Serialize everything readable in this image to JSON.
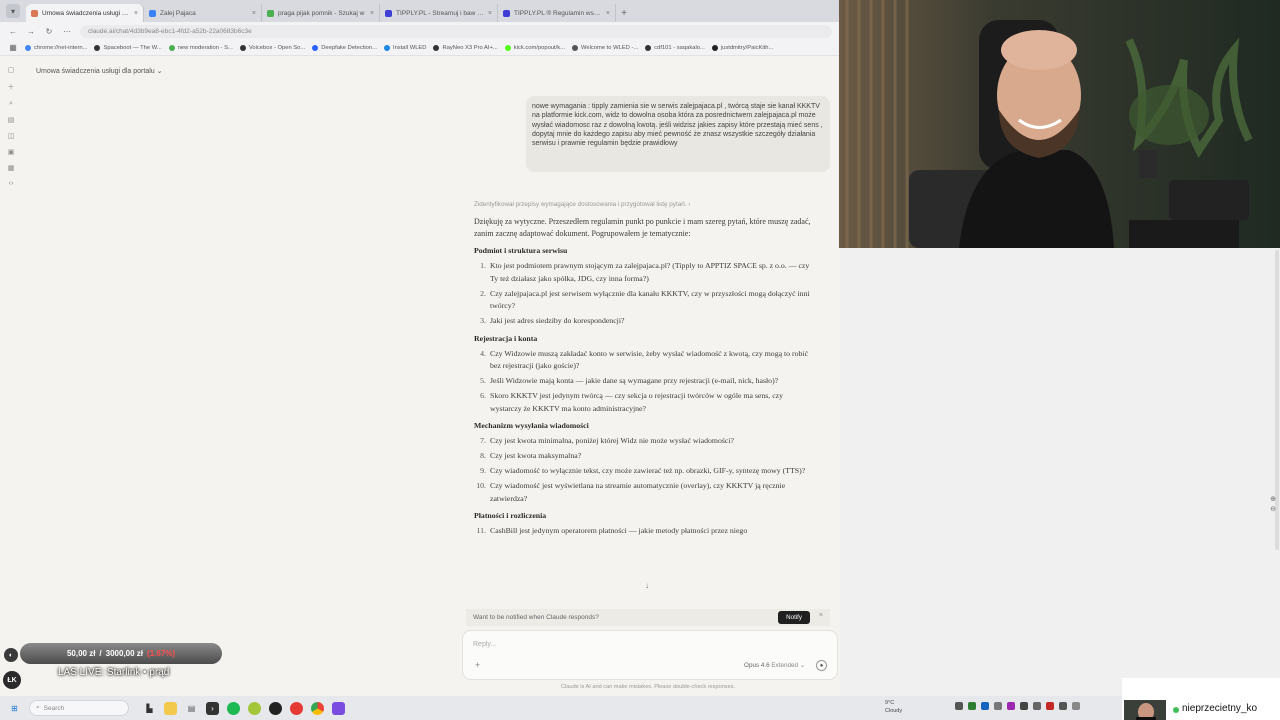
{
  "browser": {
    "tabs": [
      {
        "title": "Umowa świadczenia usługi dla",
        "color": "#d97757",
        "active": true
      },
      {
        "title": "Zalej Pajaca",
        "color": "#3b82f6",
        "active": false
      },
      {
        "title": "praga pijak pomnik - Szukaj w",
        "color": "#4caf50",
        "active": false
      },
      {
        "title": "TIPPLY.PL - Streamuj i baw się",
        "color": "#3f3fd8",
        "active": false
      },
      {
        "title": "TIPPLY.PL ® Regulamin współp",
        "color": "#3f3fd8",
        "active": false
      }
    ],
    "url": "claude.ai/chat/4d3b9ea8-ebc1-4fd2-a52b-22a0683b6c3e",
    "bookmarks": [
      {
        "label": "chrome://net-intern...",
        "color": "#4285f4"
      },
      {
        "label": "Spaceboot — The W...",
        "color": "#333333"
      },
      {
        "label": "new moderation - S...",
        "color": "#4caf50"
      },
      {
        "label": "Voicebox - Open So...",
        "color": "#333333"
      },
      {
        "label": "Deepfake Detection...",
        "color": "#2962ff"
      },
      {
        "label": "Install WLED",
        "color": "#1e88e5"
      },
      {
        "label": "RayNeo X3 Pro AI+...",
        "color": "#333333"
      },
      {
        "label": "kick.com/popout/k...",
        "color": "#53fc18"
      },
      {
        "label": "Welcome to WLED -...",
        "color": "#555555"
      },
      {
        "label": "cdf101 - saqakalo...",
        "color": "#333333"
      },
      {
        "label": "justdmitry/PaicKith...",
        "color": "#222222"
      }
    ]
  },
  "conversation": {
    "title": "Umowa świadczenia usługi dla portalu",
    "user_message": "nowe wymagania : tipply zamienia sie w serwis zalejpajaca.pl , twórcą staje sie kanał KKKTV na platformie kick.com, widz to dowolna osoba która za posrednictwem zalejpajaca.pl może wysłać wiadomosc raz z dowolną kwotą. jeśli widzisz jakies zapisy które przestają mieć sens , dopytaj mnie do każdego zapisu aby mieć pewność że znasz wszystkie szczegóły działania serwisu i prawnie regulamin będzie prawidłowy",
    "thinking": "Zidentyfikował przepisy wymagające dostosowania i przygotował listę pytań.",
    "intro": "Dziękuję za wytyczne. Przeszedłem regulamin punkt po punkcie i mam szereg pytań, które muszę zadać, zanim zacznę adaptować dokument. Pogrupowałem je tematycznie:",
    "sections": [
      {
        "heading": "Podmiot i struktura serwisu",
        "questions": [
          {
            "n": "1.",
            "text": "Kto jest podmiotem prawnym stojącym za zalejpajaca.pl? (Tipply to APPTIZ SPACE sp. z o.o. — czy Ty też działasz jako spółka, JDG, czy inna forma?)"
          },
          {
            "n": "2.",
            "text": "Czy zalejpajaca.pl jest serwisem wyłącznie dla kanału KKKTV, czy w przyszłości mogą dołączyć inni twórcy?"
          },
          {
            "n": "3.",
            "text": "Jaki jest adres siedziby do korespondencji?"
          }
        ]
      },
      {
        "heading": "Rejestracja i konta",
        "questions": [
          {
            "n": "4.",
            "text": "Czy Widzowie muszą zakładać konto w serwisie, żeby wysłać wiadomość z kwotą, czy mogą to robić bez rejestracji (jako goście)?"
          },
          {
            "n": "5.",
            "text": "Jeśli Widzowie mają konta — jakie dane są wymagane przy rejestracji (e-mail, nick, hasło)?"
          },
          {
            "n": "6.",
            "text": "Skoro KKKTV jest jedynym twórcą — czy sekcja o rejestracji twórców w ogóle ma sens, czy wystarczy że KKKTV ma konto administracyjne?"
          }
        ]
      },
      {
        "heading": "Mechanizm wysyłania wiadomości",
        "questions": [
          {
            "n": "7.",
            "text": "Czy jest kwota minimalna, poniżej której Widz nie może wysłać wiadomości?"
          },
          {
            "n": "8.",
            "text": "Czy jest kwota maksymalna?"
          },
          {
            "n": "9.",
            "text": "Czy wiadomość to wyłącznie tekst, czy może zawierać też np. obrazki, GIF-y, syntezę mowy (TTS)?"
          },
          {
            "n": "10.",
            "text": "Czy wiadomość jest wyświetlana na streamie automatycznie (overlay), czy KKKTV ją ręcznie zatwierdza?"
          }
        ]
      },
      {
        "heading": "Płatności i rozliczenia",
        "questions": [
          {
            "n": "11.",
            "text": "CashBill jest jedynym operatorem płatności — jakie metody płatności przez niego"
          }
        ]
      }
    ],
    "notify_text": "Want to be notified when Claude responds?",
    "notify_button": "Notify",
    "reply_placeholder": "Reply...",
    "model": "Opus 4.6",
    "mode": "Extended",
    "disclaimer": "Claude is AI and can make mistakes. Please double-check responses."
  },
  "overlay": {
    "goal_current": "50,00 zł",
    "goal_separator": "/",
    "goal_target": "3000,00 zł",
    "goal_percent": "(1.67%)",
    "live_text": "LAS LIVE: Starlink • prąd",
    "logo_text": "ŁK",
    "chip_text": "◐",
    "nickname": "nieprzecietny_ko"
  },
  "taskbar": {
    "search_placeholder": "Search",
    "weather_temp": "9°C",
    "weather_desc": "Cloudy"
  }
}
